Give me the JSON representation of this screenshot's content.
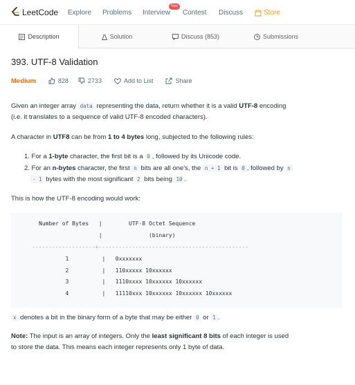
{
  "nav": {
    "logo": "LeetCode",
    "links": [
      "Explore",
      "Problems",
      "Interview",
      "Contest",
      "Discuss",
      "Store"
    ],
    "new_badge": "New"
  },
  "tabs": [
    "Description",
    "Solution",
    "Discuss (853)",
    "Submissions"
  ],
  "problem": {
    "title": "393. UTF-8 Validation",
    "difficulty": "Medium",
    "likes": "828",
    "dislikes": "2733",
    "add_to_list": "Add to List",
    "share": "Share"
  },
  "description": {
    "p1_a": "Given an integer array ",
    "p1_code": "data",
    "p1_b": " representing the data, return whether it is a valid ",
    "p1_bold": "UTF-8",
    "p1_c": " encoding",
    "p1_line2": "(i.e. it translates to a sequence of valid UTF-8 encoded characters).",
    "p2_a": "A character in ",
    "p2_bold1": "UTF8",
    "p2_b": " can be from ",
    "p2_bold2": "1 to 4 bytes",
    "p2_c": " long, subjected to the following rules:",
    "r1_a": "1. For a ",
    "r1_bold": "1-byte",
    "r1_b": " character, the first bit is a ",
    "r1_code": "0",
    "r1_c": ", followed by its Unicode code.",
    "r2_a": "2. For an ",
    "r2_bold": "n-bytes",
    "r2_b": " character, the first ",
    "r2_code1": "n",
    "r2_c": " bits are all one's, the ",
    "r2_code2": "n + 1",
    "r2_d": " bit is ",
    "r2_code3": "0",
    "r2_e": ", followed by ",
    "r2_code4": "n",
    "r2_code5": "- 1",
    "r2_f": " bytes with the most significant ",
    "r2_code6": "2",
    "r2_g": " bits being ",
    "r2_code7": "10",
    "r2_h": ".",
    "p3": "This is how the UTF-8 encoding would work:"
  },
  "table": {
    "header1": "Number of Bytes   |        UTF-8 Octet Sequence",
    "header2": "                  |              (binary)",
    "divider": "-------------------+---------------------------------------------",
    "rows": [
      "        1          |   0xxxxxxx",
      "        2          |   110xxxxx 10xxxxxx",
      "        3          |   1110xxxx 10xxxxxx 10xxxxxx",
      "        4          |   11110xxx 10xxxxxx 10xxxxxx 10xxxxxx"
    ]
  },
  "footer": {
    "x_code": "x",
    "x_text_a": " denotes a bit in the binary form of a byte that may be either ",
    "x_code0": "0",
    "x_or": " or ",
    "x_code1": "1",
    "x_end": ".",
    "note_label": "Note:",
    "note_a": " The input is an array of integers. Only the ",
    "note_bold": "least significant 8 bits",
    "note_b": " of each integer is used",
    "note_line2": "to store the data. This means each integer represents only 1 byte of data."
  }
}
